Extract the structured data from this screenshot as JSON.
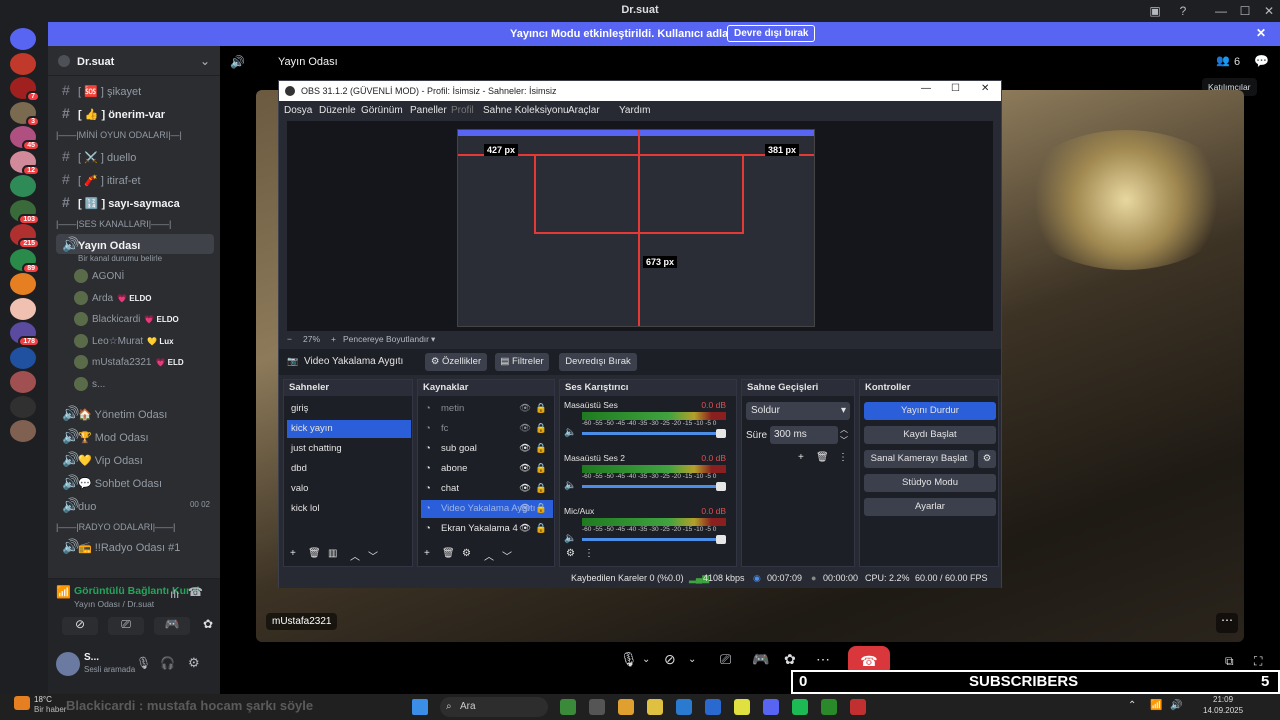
{
  "window": {
    "title": "Dr.suat",
    "controls": [
      "—",
      "☐",
      "✕"
    ]
  },
  "banner": {
    "message": "Yayıncı Modu etkinleştirildi. Kullanıcı adları kısaltıldı.",
    "button": "Devre dışı bırak",
    "close": "✕"
  },
  "guilds": [
    {
      "badge": "",
      "color": "#5865f2"
    },
    {
      "badge": "",
      "color": "#c0392b"
    },
    {
      "badge": "7",
      "color": "#a02020"
    },
    {
      "badge": "3",
      "color": "#7a6a50"
    },
    {
      "badge": "45",
      "color": "#b05080"
    },
    {
      "badge": "12",
      "color": "#d08a9a"
    },
    {
      "badge": "",
      "color": "#2e8b57"
    },
    {
      "badge": "103",
      "color": "#3a6a3a"
    },
    {
      "badge": "215",
      "color": "#b03030"
    },
    {
      "badge": "89",
      "color": "#2a8a4a"
    },
    {
      "badge": "",
      "color": "#e67e22"
    },
    {
      "badge": "",
      "color": "#f0c0b0"
    },
    {
      "badge": "178",
      "color": "#5a4aa0"
    },
    {
      "badge": "",
      "color": "#2050a0"
    },
    {
      "badge": "",
      "color": "#a05050"
    },
    {
      "badge": "",
      "color": "#303030"
    },
    {
      "badge": "",
      "color": "#806050"
    }
  ],
  "sidebar": {
    "server_name": "Dr.suat",
    "text_channels": [
      {
        "label": "[ 🆘 ] şikayet",
        "bright": false
      },
      {
        "label": "[ 👍 ] önerim-var",
        "bright": true
      }
    ],
    "cat_mini": "|——|MİNİ OYUN ODALARI|—|",
    "mini_channels": [
      {
        "label": "[ ⚔️ ] duello",
        "bright": false
      },
      {
        "label": "[ 🧨 ] itiraf-et",
        "bright": false
      },
      {
        "label": "[ 🔢 ] sayı-saymaca",
        "bright": true
      }
    ],
    "cat_voice": "|——|SES KANALLARI|——|",
    "active_voice": "Yayın Odası",
    "active_status": "Bir kanal durumu belirle",
    "voice_users": [
      {
        "name": "AGONİ",
        "tag": ""
      },
      {
        "name": "Arda",
        "tag": "💗 ELDO"
      },
      {
        "name": "Blackicardi",
        "tag": "💗 ELDO"
      },
      {
        "name": "Leo☆Murat",
        "tag": "💛 Lux"
      },
      {
        "name": "mUstafa2321",
        "tag": "💗 ELD"
      },
      {
        "name": "s...",
        "tag": ""
      }
    ],
    "voice_channels": [
      {
        "label": "🏠 Yönetim Odası"
      },
      {
        "label": "🏆 Mod Odası"
      },
      {
        "label": "💛 Vip Odası"
      },
      {
        "label": "💬 Sohbet Odası"
      },
      {
        "label": "duo",
        "extra": "00  02"
      }
    ],
    "cat_radio": "|——|RADYO ODALARI|——|",
    "radio_channel": "📻 !!Radyo Odası #1",
    "voice_panel": {
      "status": "Görüntülü Bağlantı Kurul",
      "sub": "Yayın Odası / Dr.suat"
    },
    "user_panel": {
      "name": "S...",
      "status": "Sesli aramada"
    }
  },
  "stage": {
    "channel_title": "Yayın Odası",
    "participant_count": "6",
    "tooltip": "Katılımcılar",
    "streamer_label": "mUstafa2321"
  },
  "obs": {
    "title": "OBS 31.1.2 (GÜVENLİ MOD) - Profil: İsimsiz - Sahneler: İsimsiz",
    "menu": [
      "Dosya",
      "Düzenle",
      "Görünüm",
      "Paneller",
      "Profil",
      "Sahne Koleksiyonu",
      "Araçlar",
      "Yardım"
    ],
    "measures": [
      "427 px",
      "381 px",
      "673 px"
    ],
    "zoom": "27%",
    "zoom_label": "Pencereye Boyutlandır",
    "source_toolbar": {
      "source": "Video Yakalama Aygıtı",
      "props": "Özellikler",
      "filters": "Filtreler",
      "disable": "Devredışı Bırak"
    },
    "panels": {
      "scenes": {
        "title": "Sahneler",
        "items": [
          "giriş",
          "kick yayın",
          "just chatting",
          "dbd",
          "valo",
          "kick lol"
        ],
        "selected": 1
      },
      "sources": {
        "title": "Kaynaklar",
        "items": [
          "metin",
          "fc",
          "sub goal",
          "abone",
          "chat",
          "Video Yakalama Aygıtı",
          "Ekran Yakalama 4"
        ],
        "selected": 5
      },
      "mixer": {
        "title": "Ses Karıştırıcı",
        "channels": [
          {
            "name": "Masaüstü Ses",
            "db": "0.0 dB"
          },
          {
            "name": "Masaüstü Ses 2",
            "db": "0.0 dB"
          },
          {
            "name": "Mic/Aux",
            "db": "0.0 dB"
          }
        ],
        "scale": "-60 -55 -50 -45 -40 -35 -30 -25 -20 -15 -10 -5 0"
      },
      "transitions": {
        "title": "Sahne Geçişleri",
        "type": "Soldur",
        "duration_label": "Süre",
        "duration": "300 ms"
      },
      "controls": {
        "title": "Kontroller",
        "buttons": [
          "Yayını Durdur",
          "Kaydı Başlat",
          "Sanal Kamerayı Başlat",
          "Stüdyo Modu",
          "Ayarlar"
        ]
      }
    },
    "status": {
      "dropped": "Kaybedilen Kareler 0 (%0.0)",
      "bitrate": "4108 kbps",
      "live": "00:07:09",
      "rec": "00:00:00",
      "cpu": "CPU: 2.2%",
      "fps": "60.00 / 60.00 FPS"
    }
  },
  "subscribers": {
    "left": "0",
    "label": "SUBSCRIBERS",
    "right": "5"
  },
  "taskbar": {
    "weather_temp": "18°C",
    "weather_desc": "Bir haber",
    "search": "Ara",
    "overlay_text": "Blackicardi : mustafa hocam şarkı söyle",
    "time": "21:09",
    "date": "14.09.2025"
  }
}
